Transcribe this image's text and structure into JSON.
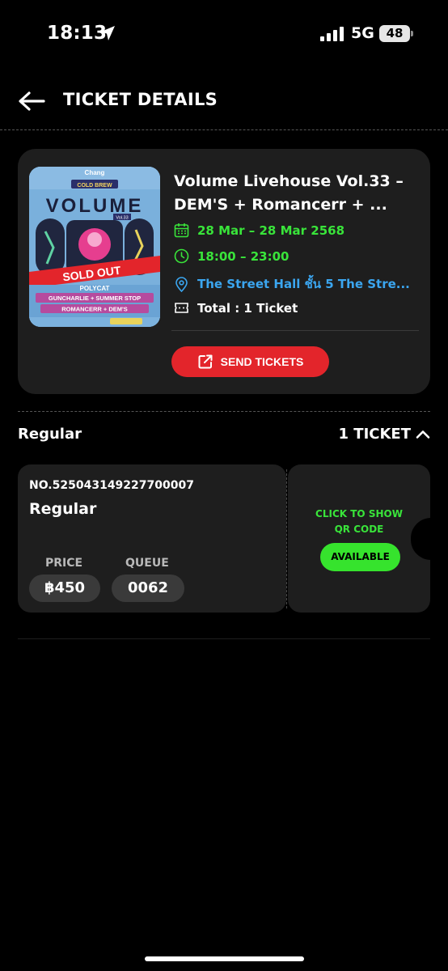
{
  "status_bar": {
    "time": "18:13",
    "network": "5G",
    "battery": "48"
  },
  "header": {
    "title": "TICKET DETAILS"
  },
  "event": {
    "title_line1": "Volume Livehouse Vol.33 –",
    "title_line2": "DEM'S + Romancerr + ...",
    "date": "28 Mar – 28 Mar 2568",
    "time": "18:00 – 23:00",
    "venue": "The Street Hall ชั้น 5 The Stre...",
    "total": "Total : 1 Ticket",
    "send_button": "SEND TICKETS",
    "poster": {
      "sponsor": "Chang",
      "sponsor_sub": "COLD BREW",
      "name": "VOLUME",
      "vol": "Vol.33",
      "sold_out": "SOLD OUT",
      "lineup1": "POLYCAT",
      "lineup2": "GUNCHARLIE + SUMMER STOP",
      "lineup3": "ROMANCERR + DEM'S"
    }
  },
  "ticket_section": {
    "label": "Regular",
    "count": "1 TICKET"
  },
  "ticket": {
    "number": "NO.525043149227700007",
    "type": "Regular",
    "price_label": "PRICE",
    "price": "฿450",
    "queue_label": "QUEUE",
    "queue": "0062",
    "qr_line1": "CLICK TO SHOW",
    "qr_line2": "QR CODE",
    "status": "AVAILABLE"
  },
  "colors": {
    "accent_green": "#39e43a",
    "link_blue": "#3ba6f0",
    "send_red": "#e3252b",
    "card_bg": "#1e1e1e"
  }
}
